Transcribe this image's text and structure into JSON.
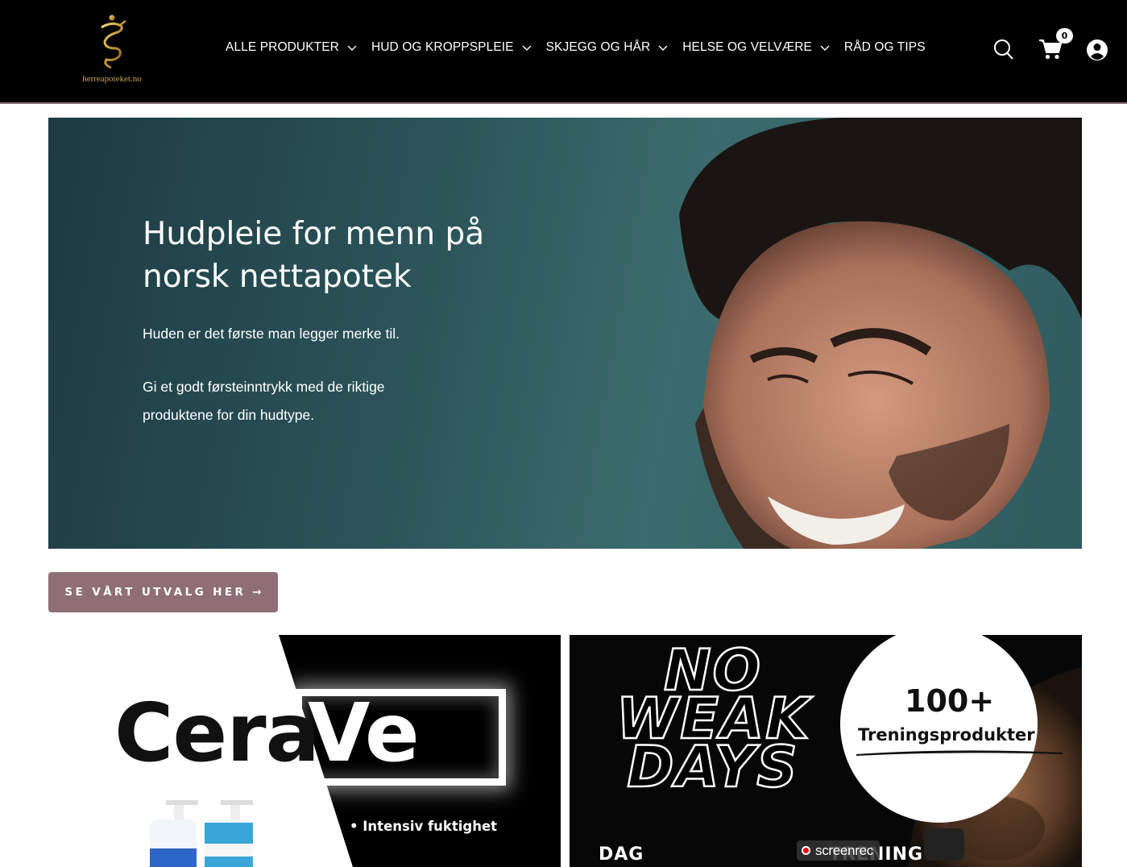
{
  "header": {
    "logo_text": "herreapoteket.no",
    "nav": [
      {
        "label": "ALLE PRODUKTER",
        "has_dropdown": true
      },
      {
        "label": "HUD OG KROPPSPLEIE",
        "has_dropdown": true
      },
      {
        "label": "SKJEGG OG HÅR",
        "has_dropdown": true
      },
      {
        "label": "HELSE OG VELVÆRE",
        "has_dropdown": true
      },
      {
        "label": "RÅD OG TIPS",
        "has_dropdown": false
      }
    ],
    "icons": {
      "search": "search-icon",
      "cart": "cart-icon",
      "account": "account-icon"
    },
    "cart_count": "0"
  },
  "hero": {
    "title": "Hudpleie for menn på norsk nettapotek",
    "paragraph1": "Huden er det første man legger merke til.",
    "paragraph2": "Gi et godt førsteinntrykk med de riktige produktene for din hudtype."
  },
  "cta": {
    "label": "SE VÅRT UTVALG HER",
    "arrow": "→"
  },
  "banners": {
    "cerave": {
      "brand_part1": "Cera",
      "brand_part2": "Ve",
      "bullet": "•  Intensiv fuktighet"
    },
    "training": {
      "headline": "NO WEAK DAYS",
      "count": "100+",
      "count_label": "Treningsprodukter",
      "bottom_left": "DAG",
      "bottom_right": "TRENING"
    }
  },
  "overlay": {
    "recorder": "screenrec"
  },
  "colors": {
    "header_bg": "#000000",
    "accent": "#8f6e76",
    "hero_bg": "#2b5359",
    "logo_gold": "#c9a556"
  }
}
